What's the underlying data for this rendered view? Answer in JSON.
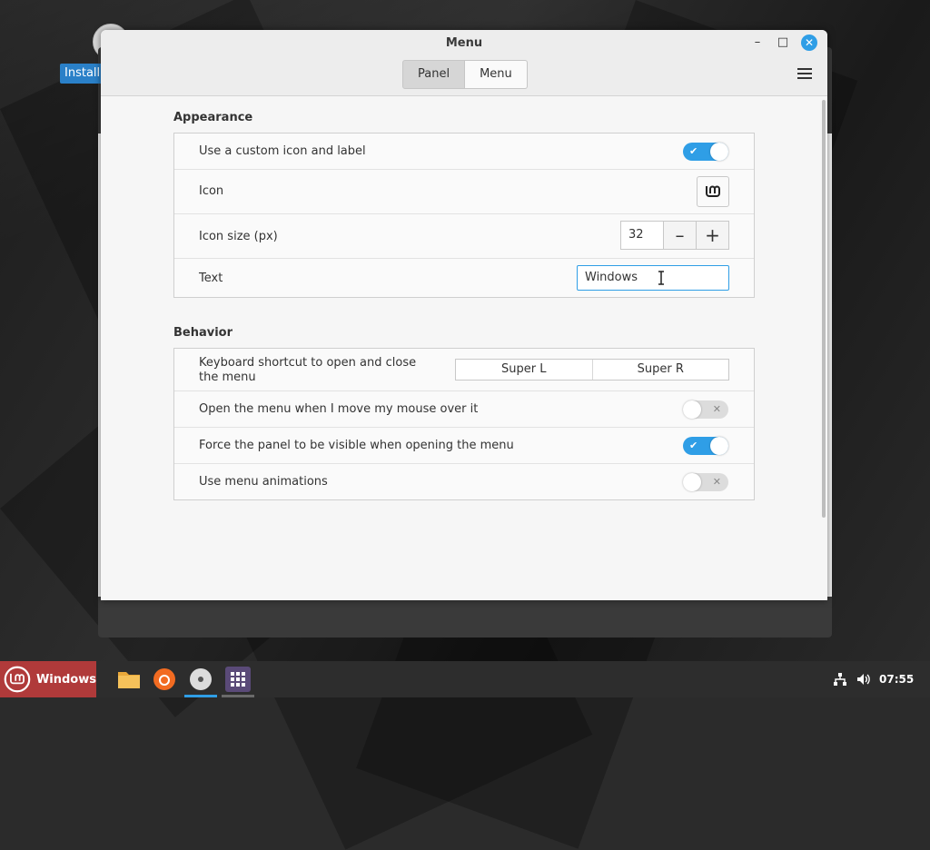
{
  "desktop": {
    "install_label": "Install"
  },
  "window": {
    "title": "Menu",
    "tabs": [
      {
        "label": "Panel",
        "active": true
      },
      {
        "label": "Menu",
        "active": false
      }
    ]
  },
  "appearance": {
    "title": "Appearance",
    "custom_icon": {
      "label": "Use a custom icon and label",
      "enabled": true
    },
    "icon": {
      "label": "Icon",
      "value_icon": "linux-mint-logo-icon"
    },
    "icon_size": {
      "label": "Icon size (px)",
      "value": "32"
    },
    "text": {
      "label": "Text",
      "value": "Windows"
    }
  },
  "behavior": {
    "title": "Behavior",
    "shortcut": {
      "label": "Keyboard shortcut to open and close the menu",
      "keys": [
        "Super L",
        "Super R"
      ]
    },
    "hover_open": {
      "label": "Open the menu when I move my mouse over it",
      "enabled": false
    },
    "force_panel": {
      "label": "Force the panel to be visible when opening the menu",
      "enabled": true
    },
    "animations": {
      "label": "Use menu animations",
      "enabled": false
    }
  },
  "taskbar": {
    "start_label": "Windows",
    "apps": [
      "files-icon",
      "firefox-icon",
      "disc-icon",
      "app-grid-icon"
    ],
    "time": "07:55"
  },
  "colors": {
    "accent": "#2f9ee6",
    "start_bg": "#b03a3a"
  }
}
